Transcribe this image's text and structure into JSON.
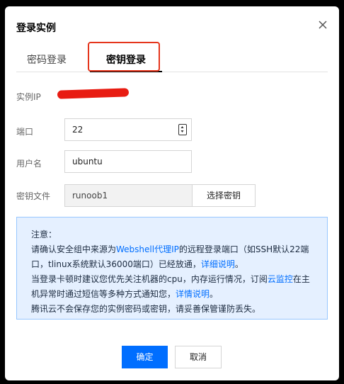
{
  "dialog": {
    "title": "登录实例"
  },
  "tabs": [
    {
      "label": "密码登录",
      "active": false
    },
    {
      "label": "密钥登录",
      "active": true
    }
  ],
  "form": {
    "ip_label": "实例IP",
    "port_label": "端口",
    "port_value": "22",
    "username_label": "用户名",
    "username_value": "ubuntu",
    "key_file_label": "密钥文件",
    "key_file_value": "runoob1",
    "select_key_button": "选择密钥"
  },
  "notice": {
    "title": "注意：",
    "line1_a": "请确认安全组中来源为",
    "line1_link": "Webshell代理IP",
    "line1_b": "的远程登录端口（如SSH默认22端口，tlinux系统默认36000端口）已经放通，",
    "line1_link2": "详细说明",
    "line1_c": "。",
    "line2_a": "当登录卡顿时建议您优先关注机器的cpu，内存运行情况，订阅",
    "line2_link": "云监控",
    "line2_b": "在主机异常时通过短信等多种方式通知您，",
    "line2_link2": "详情说明",
    "line2_c": "。",
    "line3": "腾讯云不会保存您的实例密码或密钥，请妥善保管谨防丢失。"
  },
  "footer": {
    "confirm_label": "确定",
    "cancel_label": "取消"
  },
  "colors": {
    "primary": "#006eff",
    "highlight_box": "#e5351c",
    "redaction": "#e81c12",
    "notice_bg": "#e5f0ff"
  },
  "icons": [
    "close-icon",
    "stepper-icon"
  ]
}
